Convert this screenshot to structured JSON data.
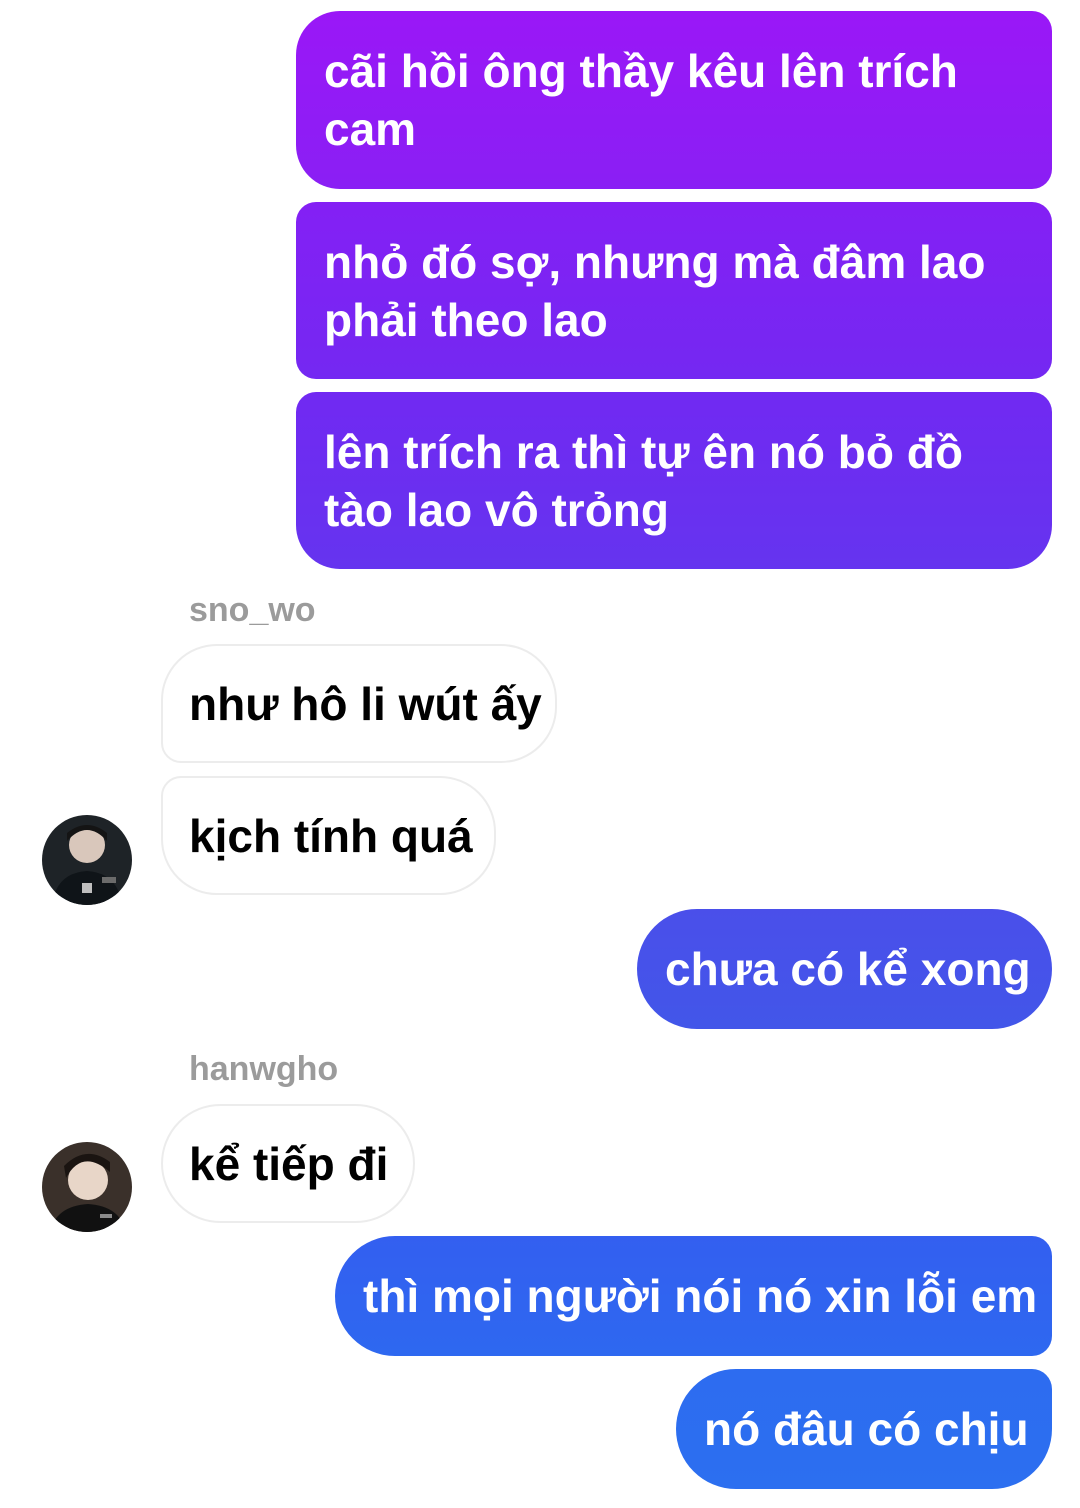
{
  "conversation": {
    "messages": [
      {
        "from": "me",
        "text": "cãi hồi ông thầy kêu lên trích cam"
      },
      {
        "from": "me",
        "text": "nhỏ đó sợ, nhưng mà đâm lao phải theo lao"
      },
      {
        "from": "me",
        "text": "lên trích ra thì tự ên nó bỏ đồ tào lao vô trỏng"
      },
      {
        "sender": "sno_wo",
        "text": "như hô li wút ấy"
      },
      {
        "sender": "sno_wo",
        "text": "kịch tính quá"
      },
      {
        "from": "me",
        "text": "chưa có kể xong"
      },
      {
        "sender": "hanwgho",
        "text": "kể tiếp đi"
      },
      {
        "from": "me",
        "text": "thì mọi người nói nó xin lỗi em"
      },
      {
        "from": "me",
        "text": "nó đâu có chịu"
      }
    ]
  },
  "colors": {
    "bubble_out_top": "#9a17f7",
    "bubble_out_mid": "#5a40ee",
    "bubble_out_bottom": "#2c6ff0",
    "bubble_in_border": "#ececec",
    "sender_name": "#9b9b9b"
  },
  "icons": {
    "avatar_1": "avatar-sno-wo-icon",
    "avatar_2": "avatar-hanwgho-icon"
  }
}
